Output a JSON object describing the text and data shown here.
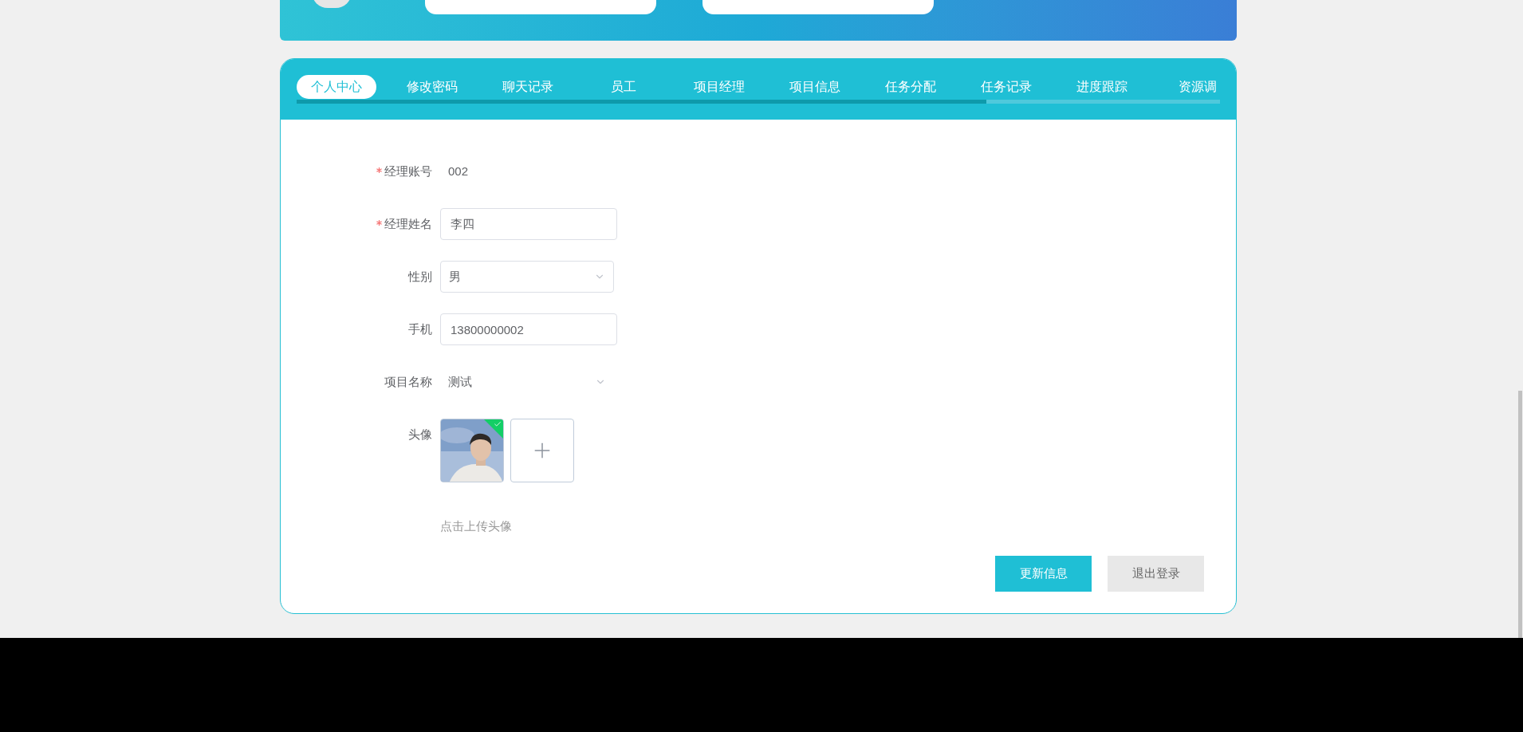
{
  "tabs": [
    {
      "label": "个人中心",
      "selected": true
    },
    {
      "label": "修改密码",
      "selected": false
    },
    {
      "label": "聊天记录",
      "selected": false
    },
    {
      "label": "员工",
      "selected": false
    },
    {
      "label": "项目经理",
      "selected": false
    },
    {
      "label": "项目信息",
      "selected": false
    },
    {
      "label": "任务分配",
      "selected": false
    },
    {
      "label": "任务记录",
      "selected": false
    },
    {
      "label": "进度跟踪",
      "selected": false
    },
    {
      "label": "资源调",
      "selected": false
    }
  ],
  "form": {
    "fields": [
      {
        "kind": "text",
        "label": "经理账号",
        "required": true,
        "value": "002"
      },
      {
        "kind": "input",
        "label": "经理姓名",
        "required": true,
        "value": "李四"
      },
      {
        "kind": "select",
        "label": "性别",
        "required": false,
        "value": "男"
      },
      {
        "kind": "input",
        "label": "手机",
        "required": false,
        "value": "13800000002"
      },
      {
        "kind": "plain-select",
        "label": "项目名称",
        "required": false,
        "value": "测试"
      },
      {
        "kind": "upload",
        "label": "头像",
        "required": false,
        "uploaded": true,
        "hint": "点击上传头像"
      }
    ]
  },
  "buttons": [
    {
      "label": "更新信息",
      "kind": "primary"
    },
    {
      "label": "退出登录",
      "kind": "secondary"
    }
  ]
}
